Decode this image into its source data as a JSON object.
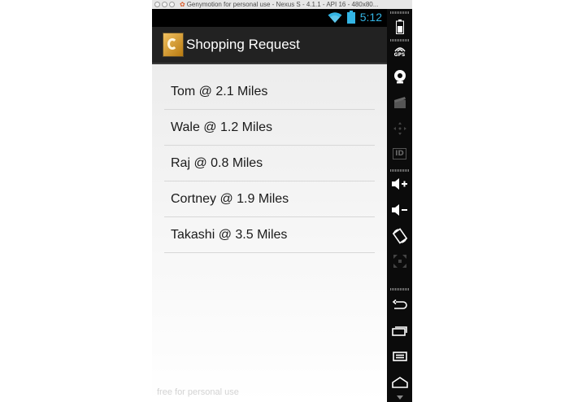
{
  "window": {
    "title": "Genymotion for personal use - Nexus S - 4.1.1 - API 16 - 480x80..."
  },
  "status_bar": {
    "time": "5:12",
    "icons": [
      "wifi-icon",
      "battery-icon"
    ]
  },
  "action_bar": {
    "title": "Shopping Request",
    "icon": "app-logo-icon"
  },
  "requests": [
    {
      "label": "Tom @ 2.1 Miles"
    },
    {
      "label": "Wale @ 1.2 Miles"
    },
    {
      "label": "Raj @ 0.8 Miles"
    },
    {
      "label": "Cortney @ 1.9 Miles"
    },
    {
      "label": "Takashi @ 3.5 Miles"
    }
  ],
  "watermark": "free for personal use",
  "toolbar": {
    "gps_label": "GPS",
    "id_label": "ID",
    "items": [
      "battery-icon",
      "gps-icon",
      "camera-icon",
      "media-icon",
      "dpad-icon",
      "id-icon",
      "volume-up-icon",
      "volume-down-icon",
      "rotate-icon",
      "scale-icon",
      "back-icon",
      "recent-apps-icon",
      "menu-icon",
      "home-icon"
    ]
  },
  "colors": {
    "clock": "#33b5e5",
    "action_bar": "#222222",
    "status_bar": "#000000"
  }
}
